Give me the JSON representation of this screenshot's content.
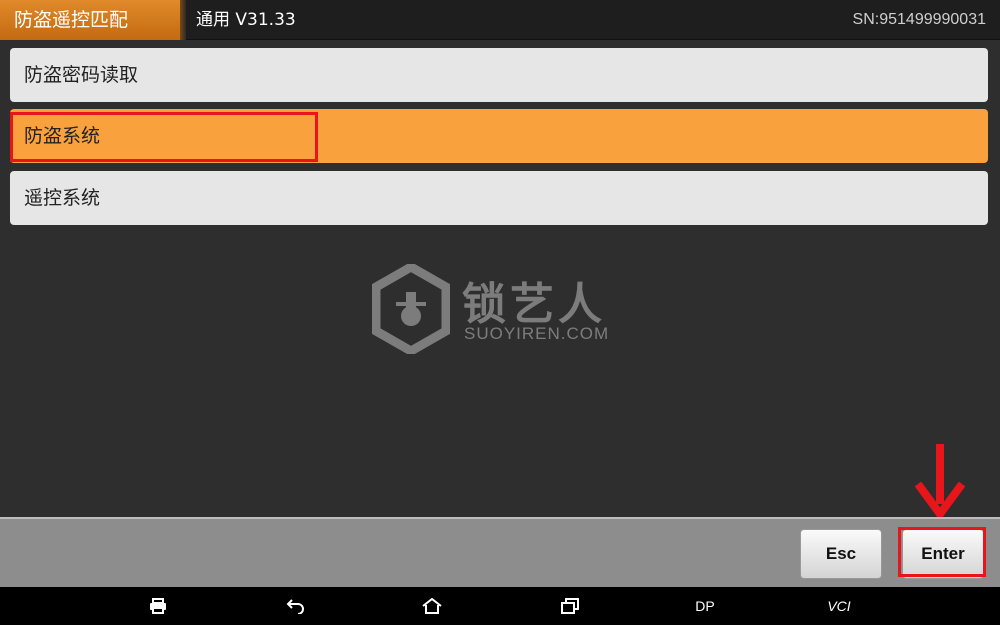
{
  "header": {
    "title": "防盗遥控匹配",
    "version": "通用  V31.33",
    "serial": "SN:951499990031"
  },
  "menu": {
    "items": [
      {
        "label": "防盗密码读取",
        "selected": false
      },
      {
        "label": "防盗系统",
        "selected": true
      },
      {
        "label": "遥控系统",
        "selected": false
      }
    ]
  },
  "watermark": {
    "brand_cn": "锁艺人",
    "brand_en": "SUOYIREN.COM"
  },
  "buttons": {
    "esc": "Esc",
    "enter": "Enter"
  },
  "nav": {
    "print_icon": "printer-icon",
    "back_icon": "back-arrow-icon",
    "home_icon": "home-icon",
    "recents_icon": "recent-apps-icon",
    "dp": "DP",
    "vci": "VCI"
  },
  "colors": {
    "accent_orange": "#f9a13c",
    "header_orange": "#e08a2a",
    "annotation_red": "#e8151b",
    "background": "#2e2e2e"
  }
}
